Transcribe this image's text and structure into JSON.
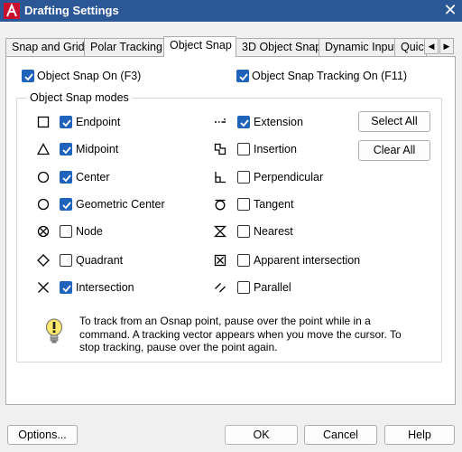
{
  "window": {
    "title": "Drafting Settings",
    "close_glyph": "✕"
  },
  "tabs": [
    {
      "label": "Snap and Grid"
    },
    {
      "label": "Polar Tracking"
    },
    {
      "label": "Object Snap",
      "active": true
    },
    {
      "label": "3D Object Snap"
    },
    {
      "label": "Dynamic Input"
    },
    {
      "label": "Quic"
    }
  ],
  "tab_arrows": {
    "left": "◀",
    "right": "▶"
  },
  "top_options": {
    "object_snap_on": {
      "label": "Object Snap On (F3)",
      "checked": true
    },
    "object_snap_tracking_on": {
      "label": "Object Snap Tracking On (F11)",
      "checked": true
    }
  },
  "modes_group": {
    "title": "Object Snap modes"
  },
  "modes_left": [
    {
      "label": "Endpoint",
      "checked": true,
      "icon": "endpoint-square-icon"
    },
    {
      "label": "Midpoint",
      "checked": true,
      "icon": "midpoint-triangle-icon"
    },
    {
      "label": "Center",
      "checked": true,
      "icon": "center-circle-icon"
    },
    {
      "label": "Geometric Center",
      "checked": true,
      "icon": "geometric-center-icon"
    },
    {
      "label": "Node",
      "checked": false,
      "icon": "node-icon"
    },
    {
      "label": "Quadrant",
      "checked": false,
      "icon": "quadrant-diamond-icon"
    },
    {
      "label": "Intersection",
      "checked": true,
      "icon": "intersection-x-icon"
    }
  ],
  "modes_right": [
    {
      "label": "Extension",
      "checked": true,
      "icon": "extension-icon"
    },
    {
      "label": "Insertion",
      "checked": false,
      "icon": "insertion-icon"
    },
    {
      "label": "Perpendicular",
      "checked": false,
      "icon": "perpendicular-icon"
    },
    {
      "label": "Tangent",
      "checked": false,
      "icon": "tangent-icon"
    },
    {
      "label": "Nearest",
      "checked": false,
      "icon": "nearest-hourglass-icon"
    },
    {
      "label": "Apparent intersection",
      "checked": false,
      "icon": "apparent-intersection-icon"
    },
    {
      "label": "Parallel",
      "checked": false,
      "icon": "parallel-icon"
    }
  ],
  "side_buttons": {
    "select_all": "Select All",
    "clear_all": "Clear All"
  },
  "info": {
    "text": "To track from an Osnap point, pause over the point while in a command.  A tracking vector appears when you move the cursor.  To stop tracking, pause over the point again."
  },
  "footer": {
    "options": "Options...",
    "ok": "OK",
    "cancel": "Cancel",
    "help": "Help"
  },
  "colors": {
    "titlebar": "#2b5797",
    "checkbox_checked": "#1f63bb",
    "app_icon_red": "#c8102e"
  }
}
